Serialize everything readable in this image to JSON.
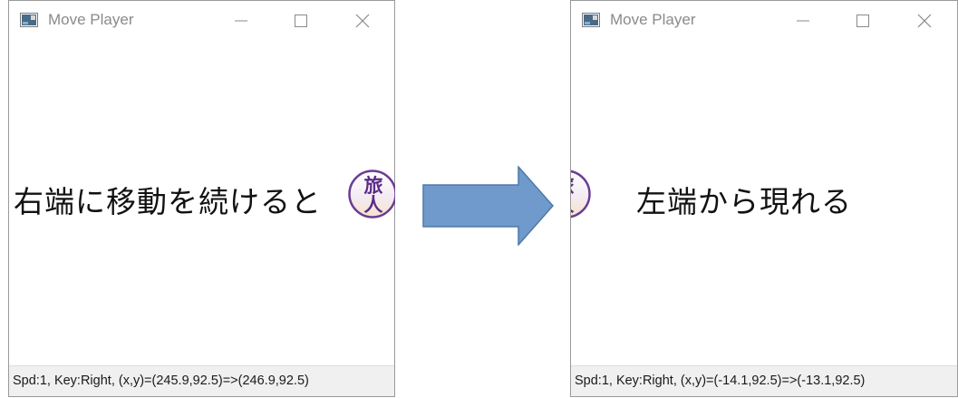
{
  "windows": [
    {
      "title": "Move Player",
      "status": "Spd:1, Key:Right, (x,y)=(245.9,92.5)=>(246.9,92.5)"
    },
    {
      "title": "Move Player",
      "status": "Spd:1, Key:Right, (x,y)=(-14.1,92.5)=>(-13.1,92.5)"
    }
  ],
  "captions": {
    "left": "右端に移動を続けると",
    "right": "左端から現れる"
  },
  "player": {
    "glyph_top": "旅",
    "glyph_bottom": "人"
  },
  "colors": {
    "arrow_fill": "#6f9acb",
    "arrow_stroke": "#4f79a8",
    "token_ring": "#6a3d93",
    "token_text": "#5a2b86"
  },
  "icons": {
    "app": "app-window-icon",
    "minimize": "minimize-icon",
    "maximize": "maximize-icon",
    "close": "close-icon",
    "arrow": "right-arrow-icon"
  }
}
